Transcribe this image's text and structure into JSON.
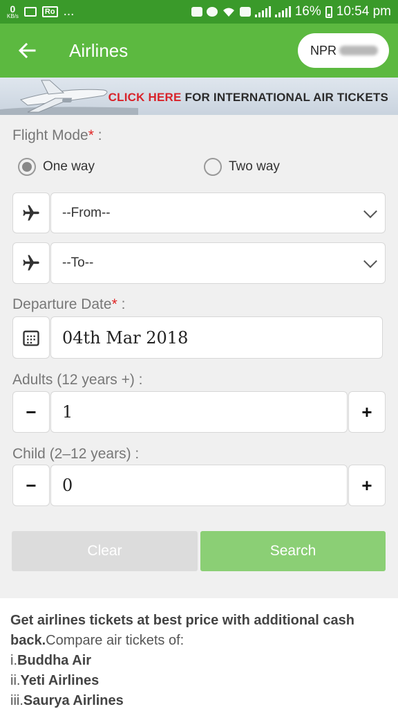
{
  "status_bar": {
    "speed_value": "0",
    "speed_unit": "KB/s",
    "ro_badge": "Ro",
    "ellipsis": "...",
    "battery": "16%",
    "time": "10:54 pm"
  },
  "app_bar": {
    "title": "Airlines",
    "currency": "NPR"
  },
  "banner": {
    "click_here": "CLICK HERE",
    "rest": "FOR INTERNATIONAL AIR TICKETS"
  },
  "form": {
    "flight_mode_label": "Flight Mode",
    "required_mark": "*",
    "colon": " :",
    "one_way": "One way",
    "two_way": "Two way",
    "selected_mode": "One way",
    "from_value": "--From--",
    "to_value": "--To--",
    "departure_label": "Departure Date",
    "departure_value": "04th Mar 2018",
    "adults_label": "Adults (12 years +) :",
    "adults_value": "1",
    "child_label": "Child (2–12 years) :",
    "child_value": "0",
    "minus": "−",
    "plus": "+"
  },
  "buttons": {
    "clear": "Clear",
    "search": "Search"
  },
  "info": {
    "lead_bold": "Get airlines tickets at best price with additional cash back.",
    "lead_rest": "Compare air tickets of:",
    "items": [
      {
        "prefix": "i.",
        "name": "Buddha Air"
      },
      {
        "prefix": "ii.",
        "name": "Yeti Airlines"
      },
      {
        "prefix": "iii.",
        "name": "Saurya Airlines"
      }
    ]
  },
  "colors": {
    "status_bar": "#3a9a2a",
    "app_bar": "#5cb940",
    "search_button": "#8bcf75",
    "clear_button": "#dcdcdc",
    "required": "#e02424",
    "banner_red": "#d8232a"
  },
  "icons": {
    "back": "arrow-left-icon",
    "from": "airplane-icon",
    "to": "airplane-icon",
    "date": "calendar-icon",
    "dropdown": "chevron-down-icon"
  }
}
